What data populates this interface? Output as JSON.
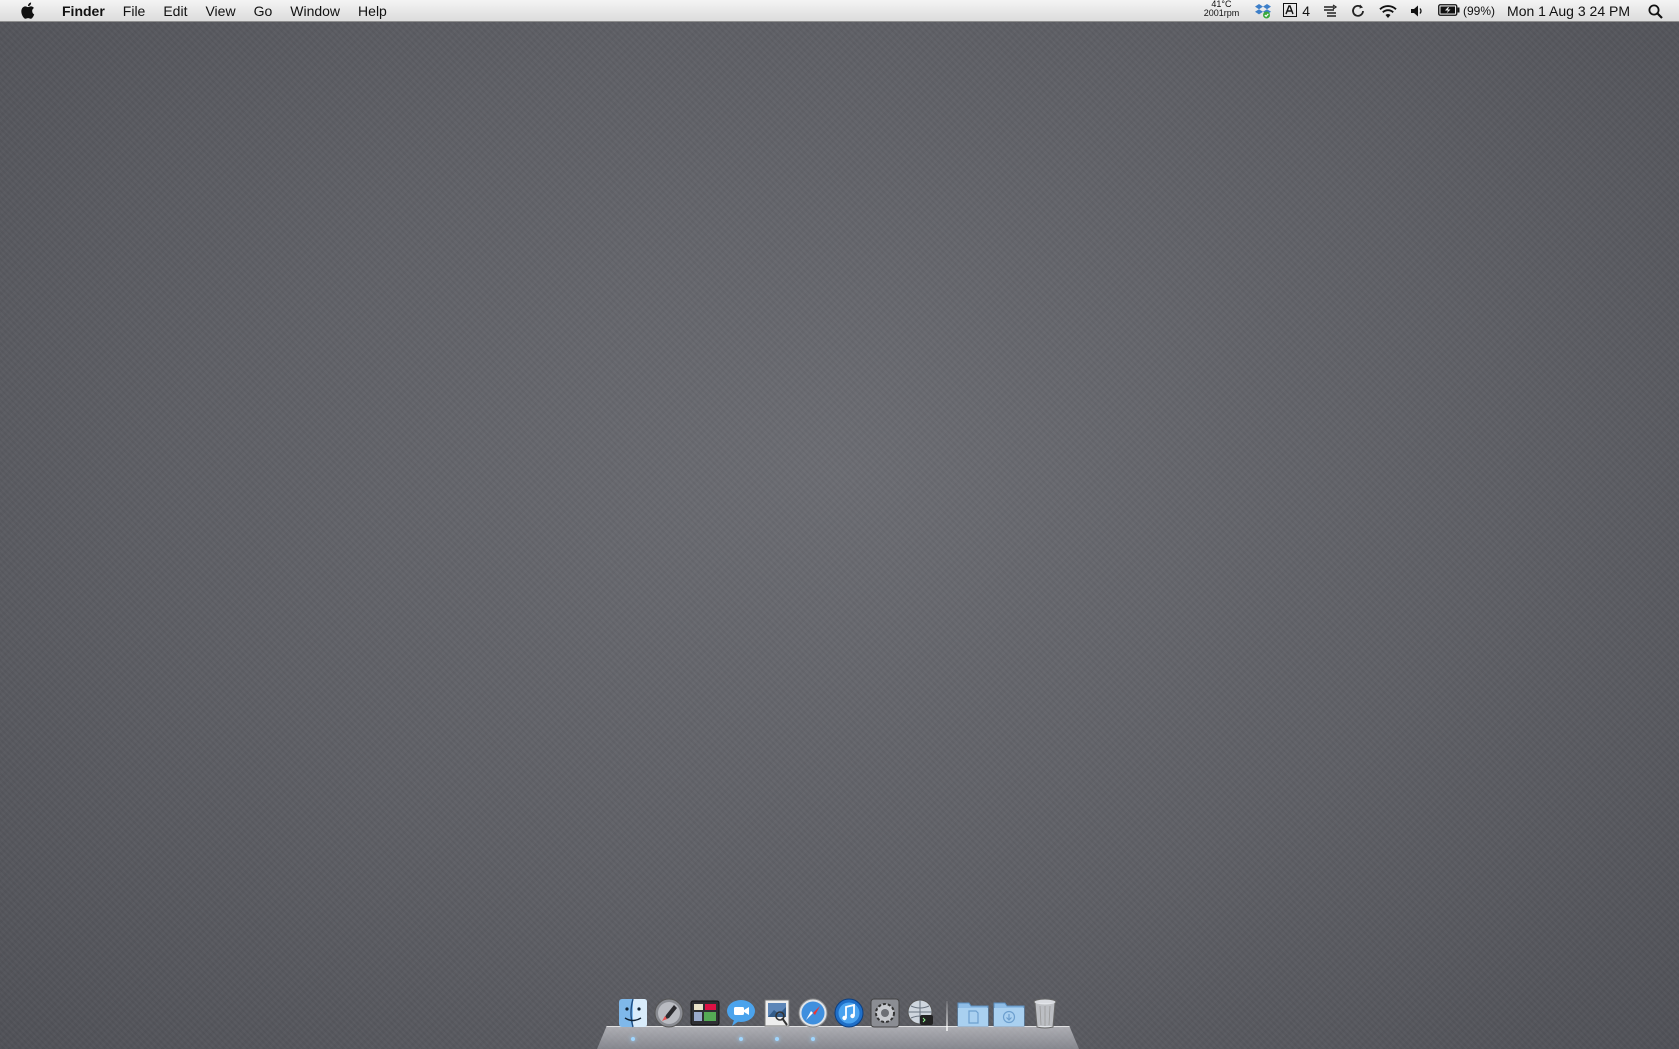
{
  "menubar": {
    "app_name": "Finder",
    "items": [
      "File",
      "Edit",
      "View",
      "Go",
      "Window",
      "Help"
    ],
    "status": {
      "temperature": "41°C",
      "fan_speed": "2001rpm",
      "adobe_badge": "4",
      "battery_percent": "(99%)",
      "datetime": "Mon 1 Aug  3 24 PM"
    }
  },
  "dock": {
    "apps": [
      {
        "name": "Finder",
        "icon": "finder-icon",
        "running": true
      },
      {
        "name": "Launchpad",
        "icon": "launchpad-icon",
        "running": false
      },
      {
        "name": "Mission Control",
        "icon": "mission-control-icon",
        "running": false
      },
      {
        "name": "FaceTime",
        "icon": "facetime-icon",
        "running": true
      },
      {
        "name": "Preview",
        "icon": "preview-icon",
        "running": true
      },
      {
        "name": "Safari",
        "icon": "safari-icon",
        "running": true
      },
      {
        "name": "iTunes",
        "icon": "itunes-icon",
        "running": false
      },
      {
        "name": "System Preferences",
        "icon": "system-preferences-icon",
        "running": false
      },
      {
        "name": "Network Utility",
        "icon": "network-utility-icon",
        "running": false
      }
    ],
    "stacks": [
      {
        "name": "Documents",
        "icon": "documents-folder-icon"
      },
      {
        "name": "Downloads",
        "icon": "downloads-folder-icon"
      }
    ],
    "trash": {
      "name": "Trash",
      "icon": "trash-icon"
    }
  },
  "colors": {
    "wallpaper": "#5f6066",
    "menubar": "#e8e8e8",
    "running_indicator": "#9fd6ff"
  }
}
